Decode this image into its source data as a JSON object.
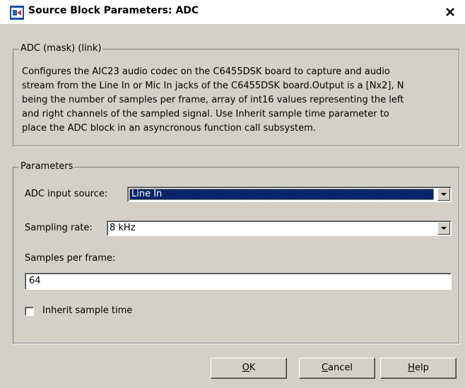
{
  "window": {
    "title": "Source Block Parameters: ADC",
    "close_label": "✕"
  },
  "description_group": {
    "legend": "ADC (mask) (link)",
    "lines": [
      "Configures the AIC23 audio codec on the C6455DSK board to capture and audio",
      "stream from the Line In or Mic In jacks of the C6455DSK board.Output is a [Nx2], N",
      "being the number of samples per frame, array of int16 values representing the left",
      "and right channels of the sampled signal. Use Inherit sample time parameter to",
      "place the ADC block in an asyncronous function call subsystem."
    ]
  },
  "parameters_group": {
    "legend": "Parameters",
    "adc_input_source": {
      "label": "ADC input source:",
      "value": "Line In"
    },
    "sampling_rate": {
      "label": "Sampling rate:",
      "value": "8 kHz"
    },
    "samples_per_frame": {
      "label": "Samples per frame:",
      "value": "64"
    },
    "inherit_sample_time": {
      "label": "Inherit sample time",
      "checked": false
    }
  },
  "buttons": {
    "ok": {
      "accel": "O",
      "rest": "K"
    },
    "cancel": {
      "accel": "C",
      "rest": "ancel"
    },
    "help": {
      "accel": "H",
      "rest": "elp"
    }
  }
}
